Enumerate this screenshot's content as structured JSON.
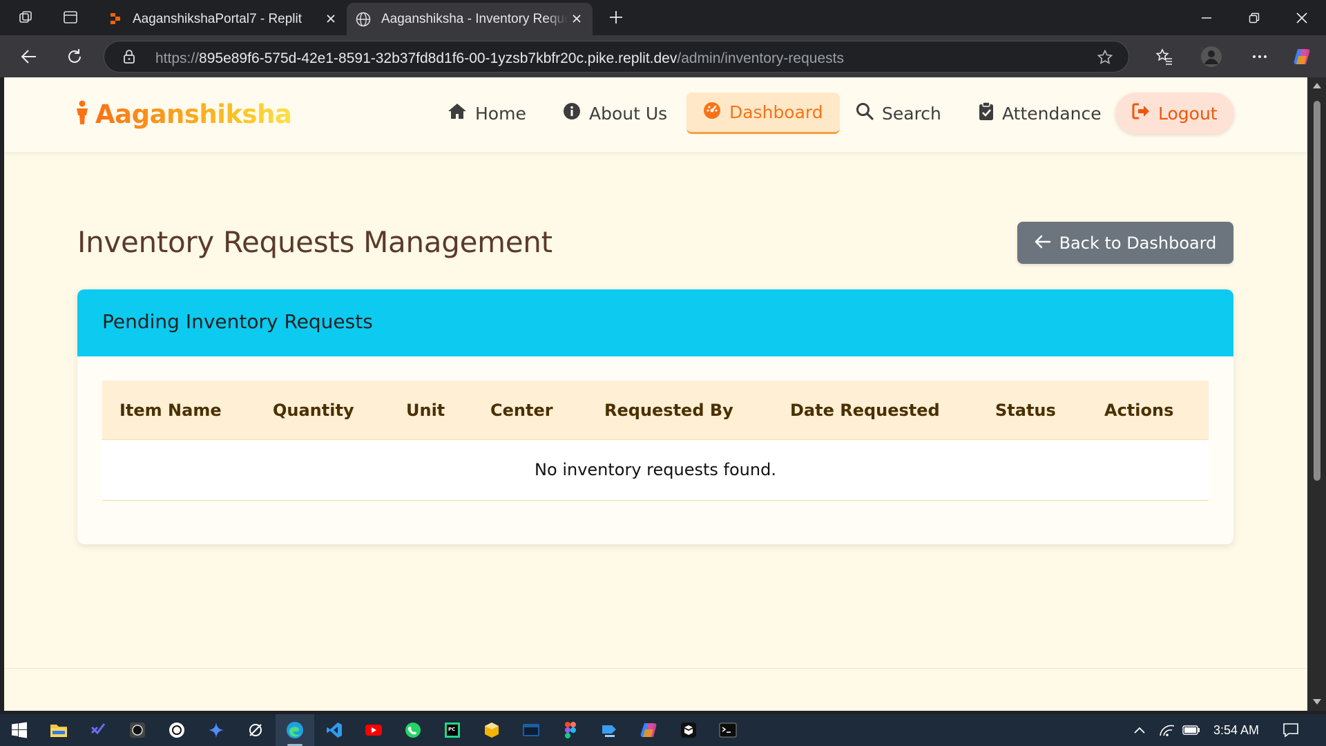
{
  "browser": {
    "tabs": [
      {
        "title": "AaganshikshaPortal7 - Replit",
        "active": false
      },
      {
        "title": "Aaganshiksha - Inventory Requests",
        "active": true
      }
    ],
    "url_prefix": "https://",
    "url_host": "895e89f6-575d-42e1-8591-32b37fd8d1f6-00-1yzsb7kbfr20c.pike.replit.dev",
    "url_path": "/admin/inventory-requests"
  },
  "site": {
    "brand": "Aaganshiksha",
    "nav": [
      {
        "label": "Home",
        "icon": "home-icon"
      },
      {
        "label": "About Us",
        "icon": "info-icon"
      },
      {
        "label": "Dashboard",
        "icon": "dashboard-icon",
        "active": true
      },
      {
        "label": "Search",
        "icon": "search-icon"
      },
      {
        "label": "Attendance",
        "icon": "clipboard-check-icon"
      },
      {
        "label": "Logout",
        "icon": "logout-icon"
      }
    ]
  },
  "page": {
    "title": "Inventory Requests Management",
    "back_button": "Back to Dashboard",
    "card_title": "Pending Inventory Requests",
    "columns": [
      "Item Name",
      "Quantity",
      "Unit",
      "Center",
      "Requested By",
      "Date Requested",
      "Status",
      "Actions"
    ],
    "empty_message": "No inventory requests found."
  },
  "taskbar": {
    "time": "3:54 AM"
  },
  "colors": {
    "accent_orange": "#f97316",
    "card_header_cyan": "#0dcaf0",
    "page_bg": "#fff9e8",
    "back_button_gray": "#6c757d"
  }
}
